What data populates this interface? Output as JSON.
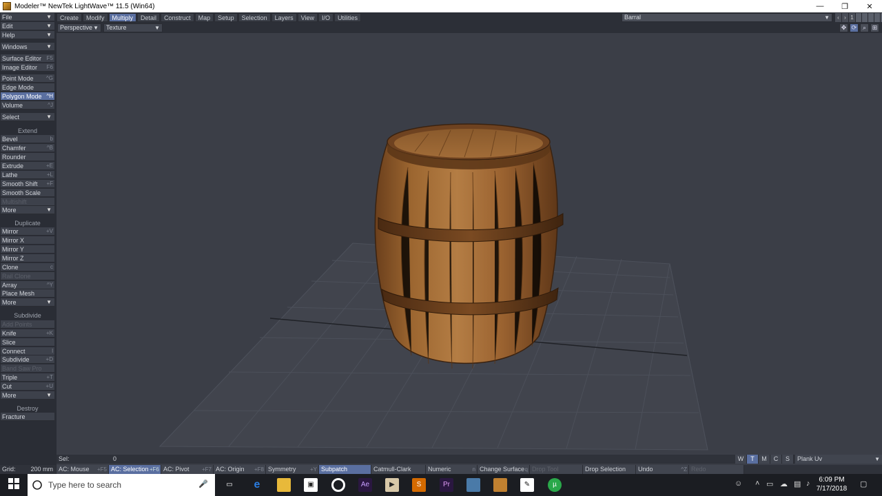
{
  "window": {
    "title": "Modeler™ NewTek LightWave™ 11.5 (Win64)",
    "minimize": "—",
    "restore": "❐",
    "close": "✕"
  },
  "menu": {
    "left": [
      "File",
      "Edit",
      "Help",
      "Windows"
    ],
    "tabs": [
      "Create",
      "Modify",
      "Multiply",
      "Detail",
      "Construct",
      "Map",
      "Setup",
      "Selection",
      "Layers",
      "View",
      "I/O",
      "Utilities"
    ],
    "active_tab": "Multiply",
    "object_name": "Barral",
    "layer_number": "1"
  },
  "viewport": {
    "view_type": "Perspective",
    "render_mode": "Texture"
  },
  "editors": {
    "surface_editor": "Surface Editor",
    "surface_editor_key": "F5",
    "image_editor": "Image Editor",
    "image_editor_key": "F6"
  },
  "modes": {
    "point": "Point Mode",
    "point_key": "^G",
    "edge": "Edge Mode",
    "polygon": "Polygon Mode",
    "polygon_key": "^H",
    "volume": "Volume",
    "volume_key": "^J",
    "select": "Select"
  },
  "extend": {
    "header": "Extend",
    "bevel": "Bevel",
    "bevel_key": "b",
    "chamfer": "Chamfer",
    "chamfer_key": "^B",
    "rounder": "Rounder",
    "extrude": "Extrude",
    "extrude_key": "+E",
    "lathe": "Lathe",
    "lathe_key": "+L",
    "smooth_shift": "Smooth Shift",
    "smooth_shift_key": "+F",
    "smooth_scale": "Smooth Scale",
    "multishift": "Multishift",
    "more": "More"
  },
  "duplicate": {
    "header": "Duplicate",
    "mirror": "Mirror",
    "mirror_key": "+V",
    "mirror_x": "Mirror X",
    "mirror_y": "Mirror Y",
    "mirror_z": "Mirror Z",
    "clone": "Clone",
    "clone_key": "c",
    "rail_clone": "Rail Clone",
    "array": "Array",
    "array_key": "^Y",
    "place_mesh": "Place Mesh",
    "more": "More"
  },
  "subdivide": {
    "header": "Subdivide",
    "add_points": "Add Points",
    "knife": "Knife",
    "knife_key": "+K",
    "slice": "Slice",
    "connect": "Connect",
    "connect_key": "l",
    "subdivide": "Subdivide",
    "subdivide_key": "+D",
    "band_saw": "Band Saw Pro",
    "triple": "Triple",
    "triple_key": "+T",
    "cut": "Cut",
    "cut_key": "+U",
    "more": "More"
  },
  "destroy": {
    "header": "Destroy",
    "fracture": "Fracture"
  },
  "status": {
    "sel_label": "Sel:",
    "sel_value": "0",
    "grid_label": "Grid:",
    "grid_value": "200 mm",
    "wtmcs": [
      "W",
      "T",
      "M",
      "C",
      "S"
    ],
    "wtmcs_active": "T",
    "uv_map": "Plank Uv",
    "ac_mouse": "AC: Mouse",
    "ac_mouse_key": "+F5",
    "ac_selection": "AC: Selection",
    "ac_selection_key": "+F6",
    "ac_pivot": "AC: Pivot",
    "ac_pivot_key": "+F7",
    "ac_origin": "AC: Origin",
    "ac_origin_key": "+F8",
    "symmetry": "Symmetry",
    "symmetry_key": "+Y",
    "subpatch": "Subpatch",
    "subpatch_type": "Catmull-Clark",
    "numeric": "Numeric",
    "numeric_key": "n",
    "change_surface": "Change Surface",
    "change_surface_key": "q",
    "drop_tool": "Drop Tool",
    "drop_selection": "Drop Selection",
    "undo": "Undo",
    "undo_key": "^Z",
    "redo": "Redo"
  },
  "taskbar": {
    "search_placeholder": "Type here to search",
    "time": "6:09 PM",
    "date": "7/17/2018"
  },
  "colors": {
    "accent": "#5a6fa0",
    "viewport_bg": "#3b3e47",
    "panel_bg": "#2a2d35",
    "button_bg": "#3d414b"
  }
}
